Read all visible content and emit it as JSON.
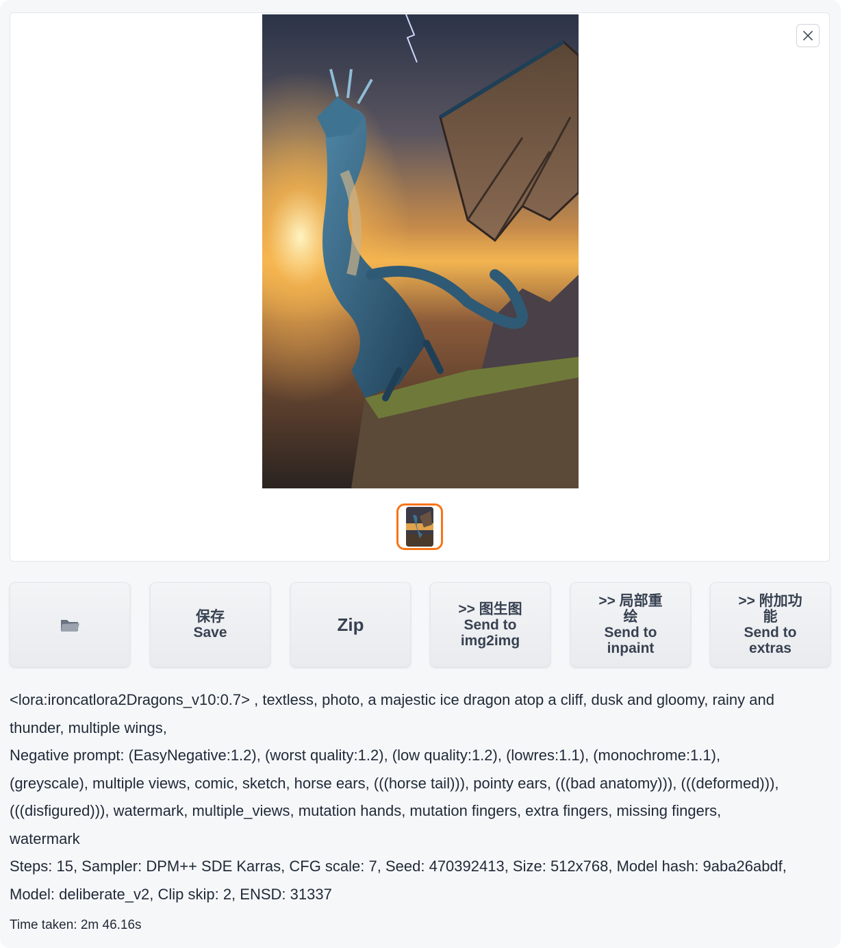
{
  "gallery": {
    "close_icon": "close-icon",
    "image_subject": "dragon-image",
    "thumbnail_selected_color": "#f97316"
  },
  "buttons": [
    {
      "id": "folder",
      "icon": "folder-icon",
      "lines": []
    },
    {
      "id": "save",
      "lines": [
        "保存",
        "Save"
      ]
    },
    {
      "id": "zip",
      "lines": [
        "Zip"
      ]
    },
    {
      "id": "img2img",
      "lines": [
        ">> 图生图",
        "Send to",
        "img2img"
      ]
    },
    {
      "id": "inpaint",
      "lines": [
        ">> 局部重",
        "绘",
        "Send to",
        "inpaint"
      ]
    },
    {
      "id": "extras",
      "lines": [
        ">> 附加功",
        "能",
        "Send to",
        "extras"
      ]
    }
  ],
  "info": {
    "prompt_line1": "<lora:ironcatlora2Dragons_v10:0.7> , textless, photo, a majestic ice dragon atop a cliff, dusk and gloomy, rainy and",
    "prompt_line2": "thunder, multiple wings,",
    "negative_line1": "Negative prompt: (EasyNegative:1.2), (worst quality:1.2), (low quality:1.2), (lowres:1.1), (monochrome:1.1),",
    "negative_line2": "(greyscale), multiple views, comic, sketch, horse ears, (((horse tail))), pointy ears, (((bad anatomy))), (((deformed))),",
    "negative_line3": "(((disfigured))), watermark, multiple_views, mutation hands, mutation fingers, extra fingers, missing fingers,",
    "negative_line4": "watermark",
    "params_line1": "Steps: 15, Sampler: DPM++ SDE Karras, CFG scale: 7, Seed: 470392413, Size: 512x768, Model hash: 9aba26abdf,",
    "params_line2": "Model: deliberate_v2, Clip skip: 2, ENSD: 31337"
  },
  "time_taken": "Time taken: 2m 46.16s"
}
